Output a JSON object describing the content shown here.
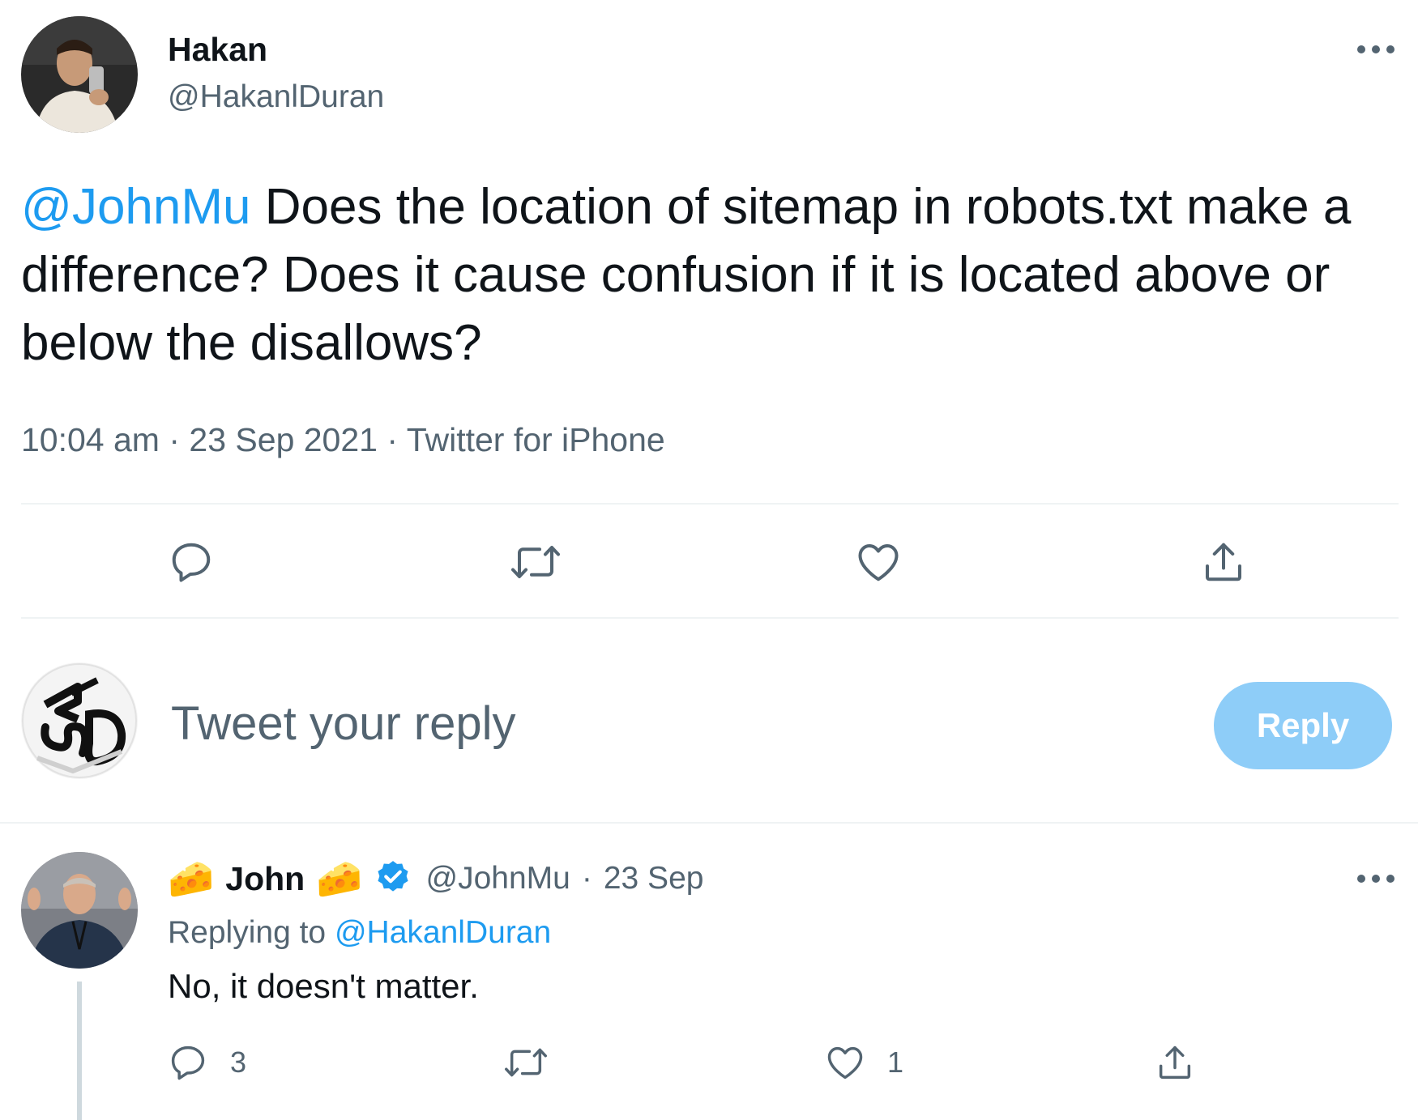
{
  "tweet": {
    "author_name": "Hakan",
    "author_handle": "@HakanlDuran",
    "mention": "@JohnMu",
    "text": " Does the location of sitemap in robots.txt make a difference? Does it cause confusion if it is located above or below the disallows?",
    "time": "10:04 am",
    "separator": "·",
    "date": "23 Sep 2021",
    "source": "Twitter for iPhone",
    "more_icon": "more-horizontal-icon",
    "actions": [
      {
        "icon": "comment-icon"
      },
      {
        "icon": "retweet-icon"
      },
      {
        "icon": "like-icon"
      },
      {
        "icon": "share-icon"
      }
    ]
  },
  "composer": {
    "avatar_logo": "SEO",
    "placeholder": "Tweet your reply",
    "reply_button_label": "Reply"
  },
  "reply": {
    "name_prefix_emoji": "🧀",
    "author_name": "John",
    "name_suffix_emoji": "🧀",
    "verified_icon": "verified-badge-icon",
    "author_handle": "@JohnMu",
    "separator": "·",
    "date": "23 Sep",
    "replying_to_label": "Replying to",
    "replying_to_handle": "@HakanlDuran",
    "text": "No, it doesn't matter.",
    "actions": [
      {
        "icon": "comment-icon",
        "count": "3"
      },
      {
        "icon": "retweet-icon",
        "count": ""
      },
      {
        "icon": "like-icon",
        "count": "1"
      },
      {
        "icon": "share-icon",
        "count": ""
      }
    ]
  },
  "colors": {
    "accent": "#1d9bf0",
    "reply_button_disabled": "#8ecdf8",
    "secondary_text": "#536471",
    "primary_text": "#0f1419",
    "verified": "#1d9bf0"
  }
}
